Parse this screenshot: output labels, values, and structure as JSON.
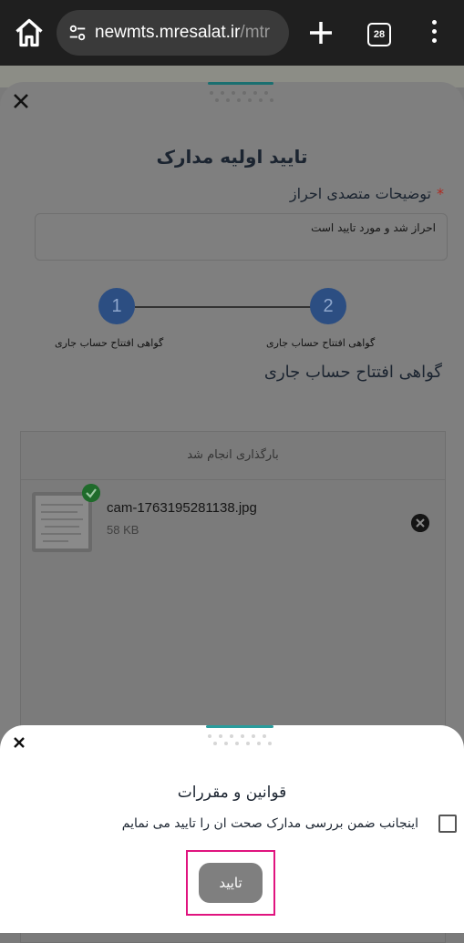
{
  "browser": {
    "url_host": "newmts.mresalat.ir",
    "url_path": "/mtr",
    "tab_count": "28"
  },
  "background_sheet": {
    "title": "تایید اولیه مدارک",
    "notes_label": "توضیحات متصدی احراز",
    "notes_value": "احراز شد و مورد تایید است",
    "steps": [
      {
        "number": "1",
        "label": "گواهی افتتاح حساب جاری"
      },
      {
        "number": "2",
        "label": "گواهی افتتاح حساب جاری"
      }
    ],
    "section_title": "گواهی افتتاح حساب جاری",
    "upload": {
      "status": "بارگذاری انجام شد",
      "file_name": "cam-1763195281138.jpg",
      "file_size": "58 KB"
    }
  },
  "rules_sheet": {
    "title": "قوانین و مقررات",
    "agreement_text": "اینجانب ضمن بررسی مدارک صحت ان را تایید می نمایم",
    "agreement_checked": false,
    "confirm_label": "تایید"
  },
  "colors": {
    "accent": "#2a9c9c",
    "highlight_frame": "#e0147f",
    "step_active": "#2c4e82"
  },
  "icons": [
    "home-icon",
    "site-settings-icon",
    "plus-icon",
    "tab-switcher-icon",
    "more-vert-icon",
    "close-icon",
    "check-circle-icon",
    "remove-icon"
  ]
}
